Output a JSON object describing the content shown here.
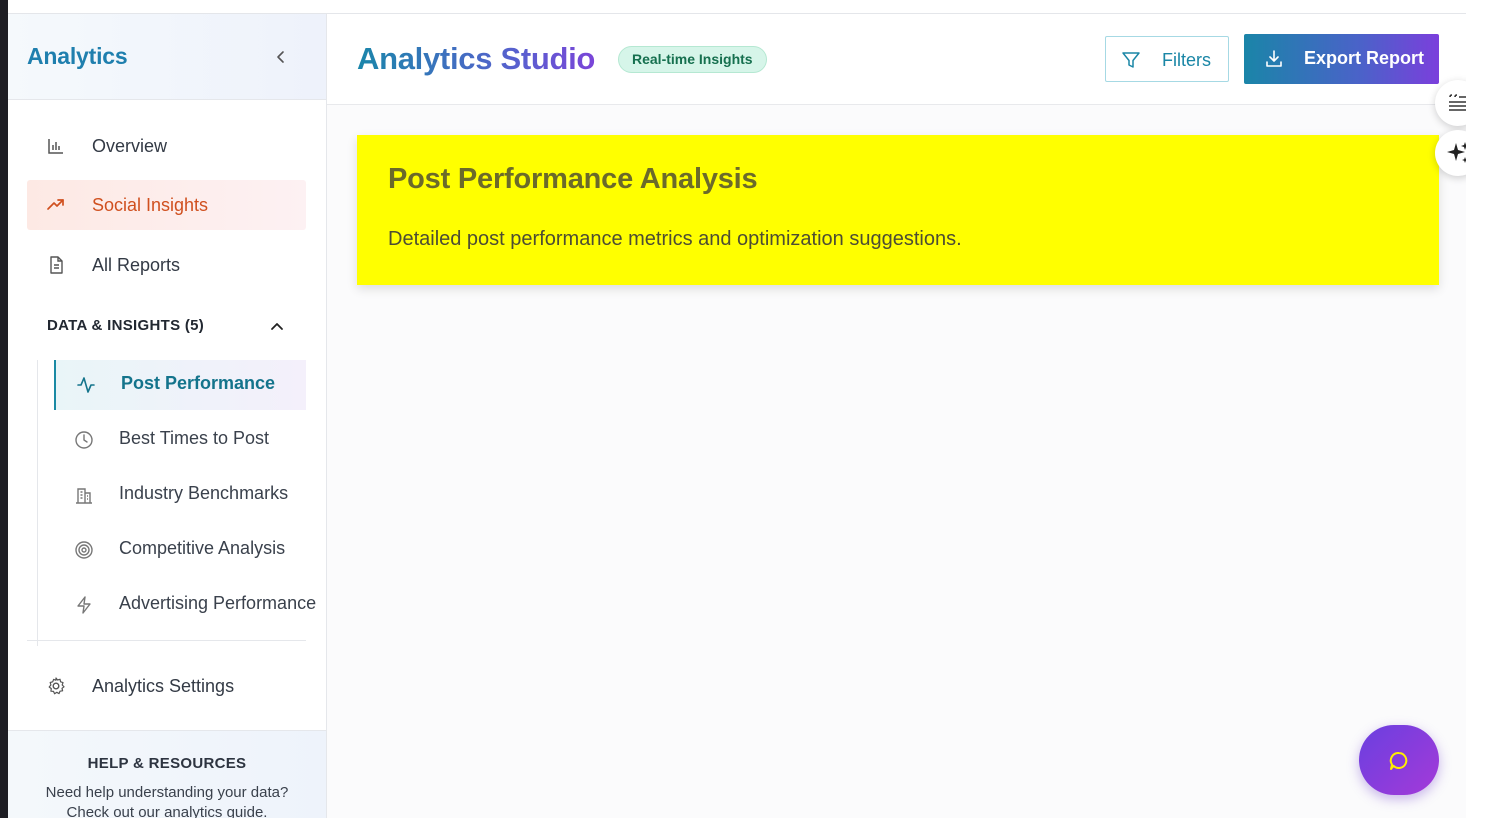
{
  "sidebar": {
    "title": "Analytics",
    "items": [
      {
        "label": "Overview",
        "icon": "bar-chart-icon"
      },
      {
        "label": "Social Insights",
        "icon": "trending-up-icon",
        "active": true
      },
      {
        "label": "All Reports",
        "icon": "document-icon"
      }
    ],
    "section": {
      "label": "DATA & INSIGHTS (5)",
      "expanded": true,
      "items": [
        {
          "label": "Post Performance",
          "icon": "activity-icon",
          "active": true
        },
        {
          "label": "Best Times to Post",
          "icon": "clock-icon"
        },
        {
          "label": "Industry Benchmarks",
          "icon": "building-icon"
        },
        {
          "label": "Competitive Analysis",
          "icon": "target-icon"
        },
        {
          "label": "Advertising Performance",
          "icon": "lightning-icon"
        }
      ]
    },
    "settings_label": "Analytics Settings",
    "help": {
      "title": "HELP & RESOURCES",
      "text": "Need help understanding your data? Check out our analytics guide."
    }
  },
  "header": {
    "title": "Analytics Studio",
    "badge": "Real-time Insights",
    "filters_label": "Filters",
    "export_label": "Export Report"
  },
  "card": {
    "title": "Post Performance Analysis",
    "description": "Detailed post performance metrics and optimization suggestions."
  },
  "colors": {
    "accent": "#1a86aa",
    "active_orange": "#d0501f",
    "card_bg": "#ffff00",
    "export_gradient_end": "#7b3fdc"
  }
}
